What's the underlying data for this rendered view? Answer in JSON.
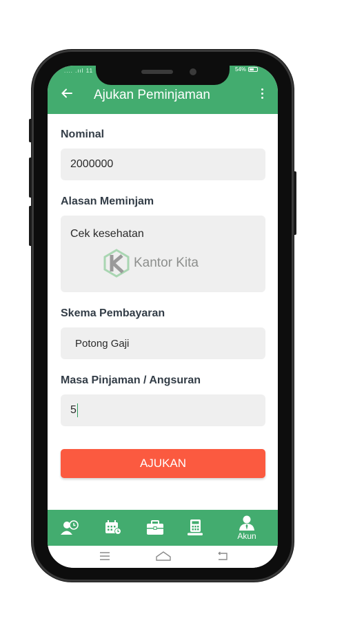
{
  "status_bar": {
    "signal": ".... .ııl 11",
    "battery": "54%"
  },
  "app_bar": {
    "title": "Ajukan Peminjaman"
  },
  "form": {
    "nominal": {
      "label": "Nominal",
      "value": "2000000"
    },
    "alasan": {
      "label": "Alasan Meminjam",
      "value": "Cek kesehatan"
    },
    "skema": {
      "label": "Skema Pembayaran",
      "value": "Potong Gaji"
    },
    "masa": {
      "label": "Masa Pinjaman / Angsuran",
      "value": "5"
    },
    "submit_label": "AJUKAN"
  },
  "watermark": {
    "text": "Kantor Kita"
  },
  "bottom_nav": {
    "items": [
      {
        "icon": "user-clock-icon",
        "label": ""
      },
      {
        "icon": "calendar-icon",
        "label": ""
      },
      {
        "icon": "briefcase-icon",
        "label": ""
      },
      {
        "icon": "calculator-money-icon",
        "label": ""
      },
      {
        "icon": "account-icon",
        "label": "Akun"
      }
    ]
  },
  "colors": {
    "primary": "#43ac6f",
    "accent": "#fb5a40",
    "field": "#efefef",
    "label": "#333d47"
  }
}
